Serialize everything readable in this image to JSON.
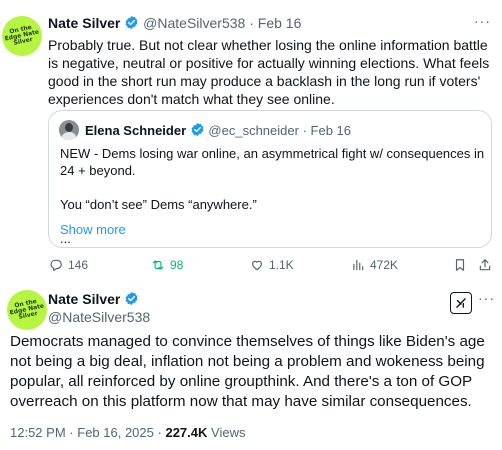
{
  "tweet1": {
    "avatar_text": "On the Edge Nate Silver",
    "author_name": "Nate Silver",
    "author_handle": "@NateSilver538",
    "separator": "·",
    "date": "Feb 16",
    "text": "Probably true. But not clear whether losing the online information battle is negative, neutral or positive for actually winning elections. What feels good in the short run may produce a backlash in the long run if voters' experiences don't match what they see online.",
    "quote": {
      "author_name": "Elena Schneider",
      "author_handle": "@ec_schneider",
      "separator": "·",
      "date": "Feb 16",
      "line1": "NEW - Dems losing war online, an asymmetrical fight w/ consequences in 24 + beyond.",
      "line2": "You “don’t see” Dems “anywhere.”",
      "line3": "...",
      "show_more": "Show more"
    },
    "actions": {
      "replies": "146",
      "reposts": "98",
      "likes": "1.1K",
      "views": "472K"
    },
    "more_icon": "···"
  },
  "tweet2": {
    "avatar_text": "On the Edge Nate Silver",
    "author_name": "Nate Silver",
    "author_handle": "@NateSilver538",
    "more_icon": "···",
    "text": "Democrats managed to convince themselves of things like Biden's age not being a big deal, inflation not being a problem and wokeness being popular, all reinforced by online groupthink. And there's a ton of GOP overreach on this platform now that may have similar consequences.",
    "time": "12:52 PM",
    "separator": "·",
    "date": "Feb 16, 2025",
    "separator2": "·",
    "views_count": "227.4K",
    "views_label": "Views"
  },
  "colors": {
    "verified": "#1d9bf0",
    "link": "#1d9bf0",
    "repost": "#00ba7c",
    "avatar_bg": "#b6f542",
    "muted": "#536471"
  }
}
